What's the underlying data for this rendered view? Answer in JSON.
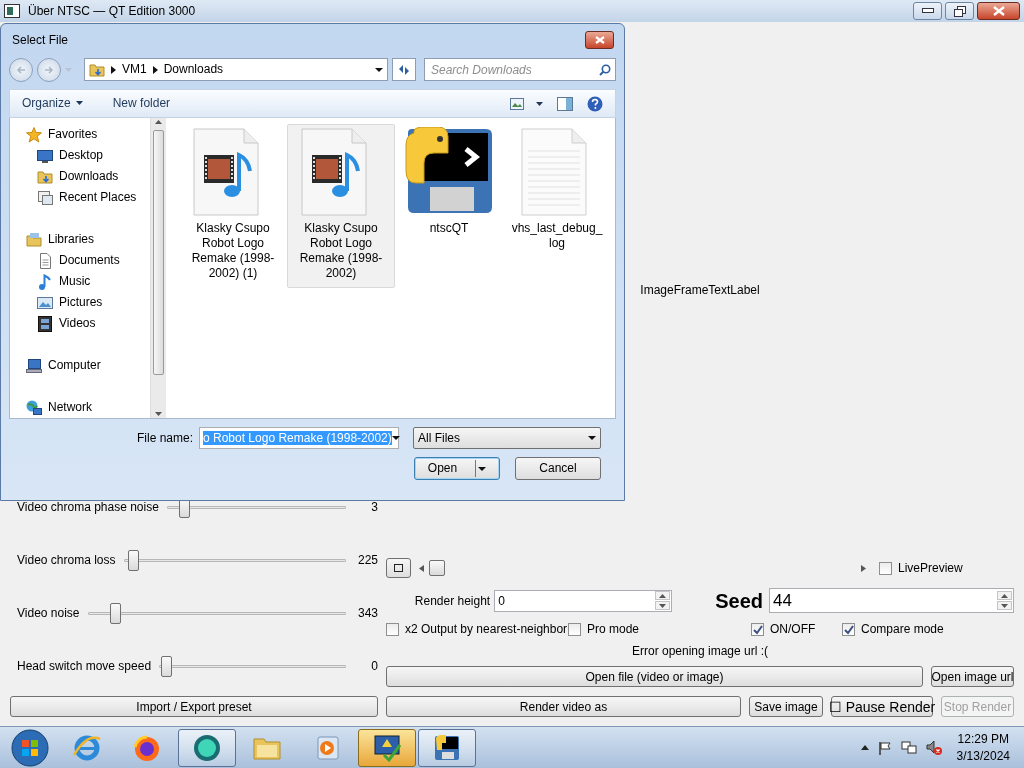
{
  "main_window": {
    "title": "Über NTSC — QT Edition 3000",
    "image_label": "ImageFrameTextLabel",
    "sliders": [
      {
        "label": "Video chroma phase noise",
        "level": 0.07,
        "value": "3"
      },
      {
        "label": "Video chroma loss",
        "level": 0.02,
        "value": "225"
      },
      {
        "label": "Video noise",
        "level": 0.09,
        "value": "343"
      },
      {
        "label": "Head switch move speed",
        "level": 0.01,
        "value": "0"
      }
    ],
    "preset_button": "Import / Export preset",
    "timeline": {
      "level": 0
    },
    "live_preview": {
      "label": "LivePreview",
      "checked": false
    },
    "render_height": {
      "label": "Render height",
      "value": "0"
    },
    "seed": {
      "label": "Seed",
      "value": "44"
    },
    "options": [
      {
        "label": "x2 Output by nearest-neighbor",
        "checked": false
      },
      {
        "label": "Pro mode",
        "checked": false
      },
      {
        "label": "ON/OFF",
        "checked": true
      },
      {
        "label": "Compare mode",
        "checked": true
      }
    ],
    "error_message": "Error opening image url :(",
    "button_rows": [
      [
        {
          "label": "Open file (video or image)",
          "disabled": false
        },
        {
          "label": "Open image url",
          "disabled": false
        }
      ],
      [
        {
          "label": "Render video as",
          "disabled": false
        },
        {
          "label": "Save image",
          "disabled": false
        },
        {
          "label": "☐ Pause Render",
          "disabled": false
        },
        {
          "label": "Stop Render",
          "disabled": true
        }
      ]
    ]
  },
  "dialog": {
    "title": "Select File",
    "path": [
      "VM1",
      "Downloads"
    ],
    "search_placeholder": "Search Downloads",
    "toolbar": [
      {
        "label": "Organize",
        "kind": "menu"
      },
      {
        "label": "New folder",
        "kind": "button"
      }
    ],
    "sidebar": [
      {
        "label": "Favorites",
        "children": [
          {
            "label": "Desktop"
          },
          {
            "label": "Downloads"
          },
          {
            "label": "Recent Places"
          }
        ]
      },
      {
        "label": "Libraries",
        "children": [
          {
            "label": "Documents"
          },
          {
            "label": "Music"
          },
          {
            "label": "Pictures"
          },
          {
            "label": "Videos"
          }
        ]
      },
      {
        "label": "Computer"
      },
      {
        "label": "Network"
      }
    ],
    "files": [
      {
        "name": "Klasky Csupo Robot Logo Remake (1998-2002) (1)",
        "kind": "video",
        "selected": false
      },
      {
        "name": "Klasky Csupo Robot Logo Remake (1998-2002)",
        "kind": "video",
        "selected": true
      },
      {
        "name": "ntscQT",
        "kind": "app",
        "selected": false
      },
      {
        "name": "vhs_last_debug_log",
        "kind": "text",
        "selected": false
      }
    ],
    "file_name": {
      "label": "File name:",
      "value": "o Robot Logo Remake (1998-2002)",
      "text_selected": true
    },
    "file_type": "All Files",
    "buttons": [
      "Open",
      "Cancel"
    ]
  },
  "taskbar": {
    "apps": [
      {
        "running": false,
        "highlighted": false
      },
      {
        "running": false,
        "highlighted": false
      },
      {
        "running": true,
        "highlighted": false
      },
      {
        "running": false,
        "highlighted": false
      },
      {
        "running": false,
        "highlighted": false
      },
      {
        "running": true,
        "highlighted": true
      },
      {
        "running": true,
        "highlighted": false
      }
    ],
    "time": "12:29 PM",
    "date": "3/13/2024"
  }
}
